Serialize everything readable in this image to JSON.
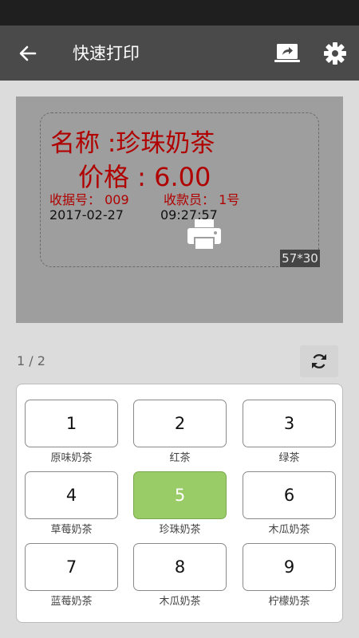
{
  "app_bar": {
    "title": "快速打印",
    "back_icon": "arrow-left-icon",
    "cast_icon": "screen-share-icon",
    "settings_icon": "gear-icon"
  },
  "preview": {
    "name_line": "名称 :珍珠奶茶",
    "price_line": "价格 : 6.00",
    "receipt_line": "收据号： 009",
    "cashier_line": "收款员： 1号",
    "date": "2017-02-27",
    "time": "09:27:57",
    "label_size": "57*30",
    "print_icon": "printer-icon"
  },
  "pager": {
    "indicator": "1 / 2",
    "refresh_icon": "refresh-icon"
  },
  "keys": [
    {
      "number": "1",
      "caption": "原味奶茶",
      "selected": false
    },
    {
      "number": "2",
      "caption": "红茶",
      "selected": false
    },
    {
      "number": "3",
      "caption": "绿茶",
      "selected": false
    },
    {
      "number": "4",
      "caption": "草莓奶茶",
      "selected": false
    },
    {
      "number": "5",
      "caption": "珍珠奶茶",
      "selected": true
    },
    {
      "number": "6",
      "caption": "木瓜奶茶",
      "selected": false
    },
    {
      "number": "7",
      "caption": "蓝莓奶茶",
      "selected": false
    },
    {
      "number": "8",
      "caption": "木瓜奶茶",
      "selected": false
    },
    {
      "number": "9",
      "caption": "柠檬奶茶",
      "selected": false
    }
  ],
  "colors": {
    "app_bar": "#4a4a4a",
    "label_text": "#b00000",
    "selected_key": "#99cc66"
  }
}
